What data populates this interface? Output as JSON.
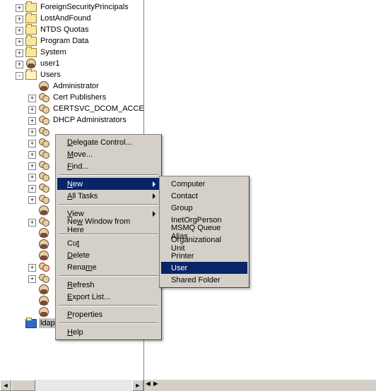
{
  "tree": {
    "nodes": [
      {
        "indent": 1,
        "exp": "+",
        "icon": "folder",
        "label": "ForeignSecurityPrincipals"
      },
      {
        "indent": 1,
        "exp": "+",
        "icon": "folder",
        "label": "LostAndFound"
      },
      {
        "indent": 1,
        "exp": "+",
        "icon": "folder",
        "label": "NTDS Quotas"
      },
      {
        "indent": 1,
        "exp": "+",
        "icon": "folder",
        "label": "Program Data"
      },
      {
        "indent": 1,
        "exp": "+",
        "icon": "folder",
        "label": "System"
      },
      {
        "indent": 1,
        "exp": "+",
        "icon": "user",
        "label": "user1"
      },
      {
        "indent": 1,
        "exp": "-",
        "icon": "folder-open",
        "label": "Users"
      },
      {
        "indent": 2,
        "exp": "",
        "icon": "user",
        "label": "Administrator"
      },
      {
        "indent": 2,
        "exp": "+",
        "icon": "group",
        "label": "Cert Publishers"
      },
      {
        "indent": 2,
        "exp": "+",
        "icon": "group",
        "label": "CERTSVC_DCOM_ACCESS"
      },
      {
        "indent": 2,
        "exp": "+",
        "icon": "group",
        "label": "DHCP Administrators"
      },
      {
        "indent": 2,
        "exp": "+",
        "icon": "group",
        "label": ""
      },
      {
        "indent": 2,
        "exp": "+",
        "icon": "group",
        "label": ""
      },
      {
        "indent": 2,
        "exp": "+",
        "icon": "group",
        "label": ""
      },
      {
        "indent": 2,
        "exp": "+",
        "icon": "group",
        "label": ""
      },
      {
        "indent": 2,
        "exp": "+",
        "icon": "group",
        "label": ""
      },
      {
        "indent": 2,
        "exp": "+",
        "icon": "group",
        "label": ""
      },
      {
        "indent": 2,
        "exp": "+",
        "icon": "group",
        "label": ""
      },
      {
        "indent": 2,
        "exp": "",
        "icon": "user",
        "label": ""
      },
      {
        "indent": 2,
        "exp": "+",
        "icon": "group",
        "label": ""
      },
      {
        "indent": 2,
        "exp": "",
        "icon": "user",
        "label": ""
      },
      {
        "indent": 2,
        "exp": "",
        "icon": "user",
        "label": ""
      },
      {
        "indent": 2,
        "exp": "",
        "icon": "user",
        "label": ""
      },
      {
        "indent": 2,
        "exp": "+",
        "icon": "group-r",
        "label": ""
      },
      {
        "indent": 2,
        "exp": "+",
        "icon": "group",
        "label": ""
      },
      {
        "indent": 2,
        "exp": "",
        "icon": "user",
        "label": ""
      },
      {
        "indent": 2,
        "exp": "",
        "icon": "user",
        "label": ""
      },
      {
        "indent": 2,
        "exp": "",
        "icon": "user",
        "label": ""
      },
      {
        "indent": 1,
        "exp": "",
        "icon": "folder-sel",
        "label": "ldapuser",
        "selected": true
      }
    ]
  },
  "menu1": {
    "items": [
      {
        "label": "Delegate Control...",
        "u": 0
      },
      {
        "label": "Move...",
        "u": 0
      },
      {
        "label": "Find...",
        "u": 0
      },
      {
        "sep": true
      },
      {
        "label": "New",
        "u": 0,
        "arrow": true,
        "hi": true
      },
      {
        "label": "All Tasks",
        "u": 0,
        "arrow": true
      },
      {
        "sep": true
      },
      {
        "label": "View",
        "u": 0,
        "arrow": true
      },
      {
        "label": "New Window from Here",
        "u": 2
      },
      {
        "sep": true
      },
      {
        "label": "Cut",
        "u": 2
      },
      {
        "label": "Delete",
        "u": 0
      },
      {
        "label": "Rename",
        "u": 4
      },
      {
        "sep": true
      },
      {
        "label": "Refresh",
        "u": 0
      },
      {
        "label": "Export List...",
        "u": 0
      },
      {
        "sep": true
      },
      {
        "label": "Properties",
        "u": 0
      },
      {
        "sep": true
      },
      {
        "label": "Help",
        "u": 0
      }
    ]
  },
  "menu2": {
    "items": [
      {
        "label": "Computer"
      },
      {
        "label": "Contact"
      },
      {
        "label": "Group"
      },
      {
        "label": "InetOrgPerson"
      },
      {
        "label": "MSMQ Queue Alias"
      },
      {
        "label": "Organizational Unit"
      },
      {
        "label": "Printer"
      },
      {
        "label": "User",
        "hi": true
      },
      {
        "label": "Shared Folder"
      }
    ]
  }
}
